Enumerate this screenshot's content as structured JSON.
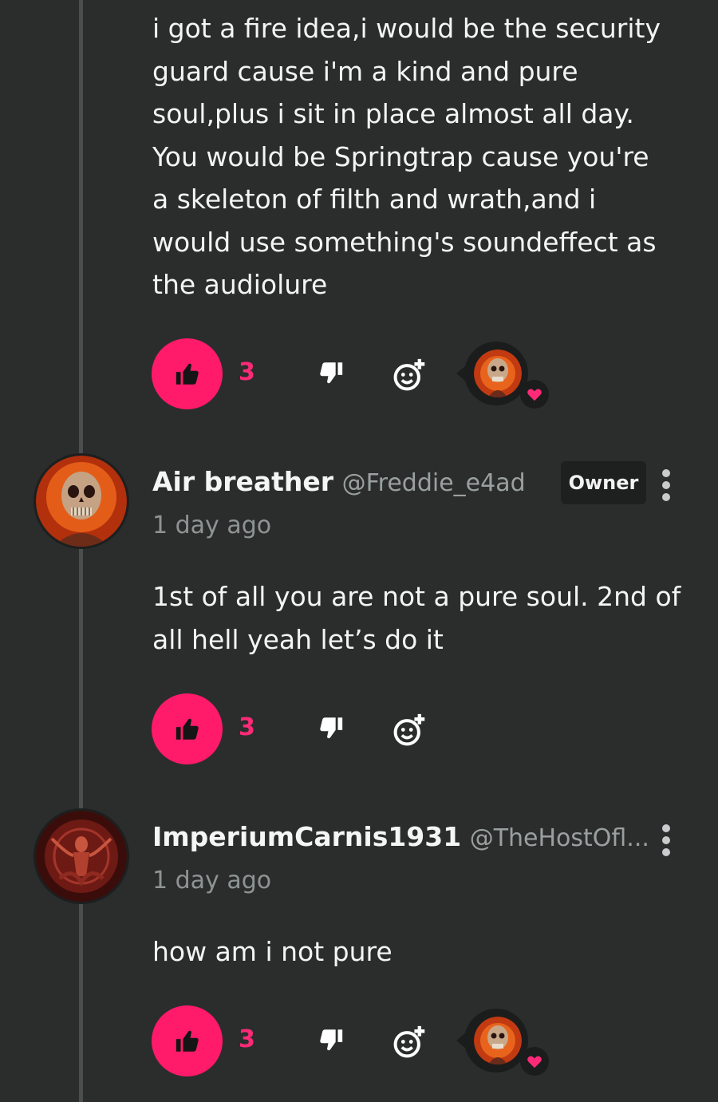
{
  "comments": [
    {
      "text": "i got a fire idea,i would be the security\nguard cause i'm a kind and pure\nsoul,plus i sit in place almost all day.\nYou would be Springtrap cause you're\na skeleton of filth and wrath,and i\nwould use something's soundeffect as\nthe audiolure",
      "likes": "3",
      "creator_hearted": true
    },
    {
      "author": "Air breather",
      "handle": "@Freddie_e4ad",
      "badge": "Owner",
      "time": "1 day ago",
      "text": "1st of all you are not a pure soul. 2nd of\nall hell yeah let’s do it",
      "likes": "3",
      "creator_hearted": false
    },
    {
      "author": "ImperiumCarnis1931",
      "handle": "@TheHostOfl...",
      "time": "1 day ago",
      "text": "how am i not pure",
      "likes": "3",
      "creator_hearted": true
    }
  ],
  "icons": {
    "like": "thumbs-up-icon",
    "dislike": "thumbs-down-icon",
    "react": "add-reaction-icon",
    "more": "more-vertical-icon",
    "heart": "heart-icon"
  },
  "colors": {
    "background": "#2b2d2d",
    "accent": "#ff1a6a",
    "text": "#f4f4f4",
    "muted": "#8e9494"
  }
}
